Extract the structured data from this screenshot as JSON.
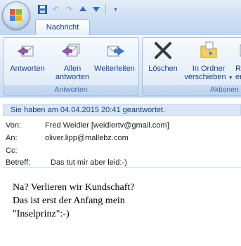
{
  "tabs": [
    {
      "label": "Nachricht"
    }
  ],
  "ribbon": {
    "groups": [
      {
        "label": "Antworten"
      },
      {
        "label": "Aktionen"
      }
    ],
    "buttons": {
      "reply": "Antworten",
      "reply_all_1": "Allen",
      "reply_all_2": "antworten",
      "forward": "Weiterleiten",
      "delete": "Löschen",
      "move_1": "In Ordner",
      "move_2": "verschieben",
      "partial_1": "R",
      "partial_2": "er"
    }
  },
  "infobar": "Sie haben am 04.04.2015 20:41 geantwortet.",
  "header": {
    "from_label": "Von:",
    "from_value": "Fred Weidler [weidlertv@gmail.com]",
    "to_label": "An:",
    "to_value": "oliver.lipp@mallebz.com",
    "cc_label": "Cc:",
    "cc_value": "",
    "subject_label": "Betreff:",
    "subject_value": "Das tut mir aber leid:-)"
  },
  "body": {
    "lines": [
      "Na? Verlieren wir Kundschaft?",
      "Das ist erst der Anfang mein",
      "\"Inselprinz\":-)"
    ]
  },
  "colors": {
    "accent": "#15428b",
    "ribbon_label": "#3e6aaa",
    "infobar": "#dbe7f6"
  }
}
